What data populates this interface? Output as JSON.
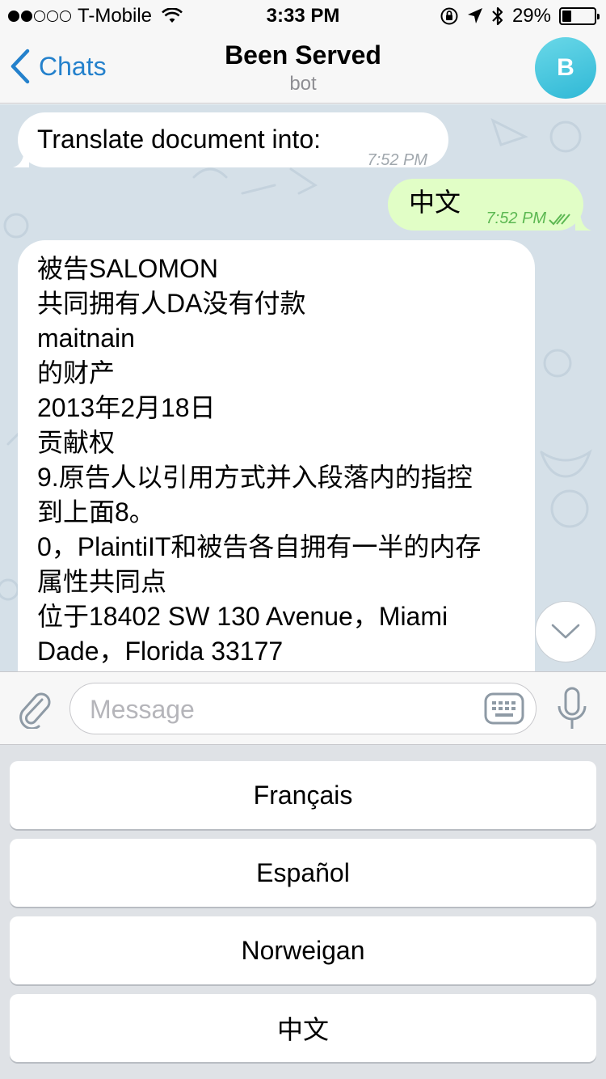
{
  "status_bar": {
    "carrier": "T-Mobile",
    "time": "3:33 PM",
    "battery": "29%",
    "battery_level": 0.29,
    "signal_bars_filled": 2,
    "signal_bars_total": 5
  },
  "header": {
    "back_label": "Chats",
    "title": "Been Served",
    "subtitle": "bot",
    "avatar_letter": "B",
    "accent_color": "#2481cc"
  },
  "messages": [
    {
      "direction": "incoming",
      "text": "Translate document into:",
      "time": "7:52 PM"
    },
    {
      "direction": "outgoing",
      "text": "中文",
      "time": "7:52 PM",
      "read": true
    },
    {
      "direction": "incoming",
      "lines": [
        "被告SALOMON",
        "共同拥有人DA没有付款",
        "maitnain",
        "的财产",
        "2013年2月18日",
        "贡献权",
        "9.原告人以引用方式并入段落内的指控",
        "到上面8。",
        "0，PlaintiIT和被告各自拥有一半的内存",
        "属性共同点",
        "位于18402 SW 130 Avenue，Miami",
        "Dade，Florida 33177"
      ]
    }
  ],
  "input": {
    "placeholder": "Message",
    "value": ""
  },
  "keyboard_buttons": [
    "Français",
    "Español",
    "Norweigan",
    "中文"
  ]
}
